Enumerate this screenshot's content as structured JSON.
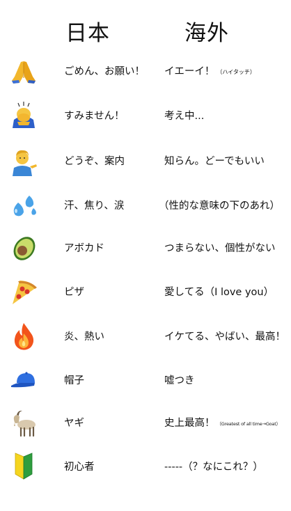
{
  "header": {
    "japan": "日本",
    "overseas": "海外"
  },
  "rows": [
    {
      "emoji": "folded-hands-icon",
      "japan": "ごめん、お願い！",
      "overseas": "イエーイ！",
      "overseas_note": "（ハイタッチ）"
    },
    {
      "emoji": "person-bowing-icon",
      "japan": "すみません！",
      "overseas": "考え中...",
      "overseas_note": ""
    },
    {
      "emoji": "person-tipping-hand-icon",
      "japan": "どうぞ、案内",
      "overseas": "知らん。どーでもいい",
      "overseas_note": ""
    },
    {
      "emoji": "sweat-droplets-icon",
      "japan": "汗、焦り、涙",
      "overseas": "（性的な意味の下のあれ）",
      "overseas_note": ""
    },
    {
      "emoji": "avocado-icon",
      "japan": "アボカド",
      "overseas": "つまらない、個性がない",
      "overseas_note": ""
    },
    {
      "emoji": "pizza-icon",
      "japan": "ピザ",
      "overseas": "愛してる（I love you）",
      "overseas_note": ""
    },
    {
      "emoji": "fire-icon",
      "japan": "炎、熱い",
      "overseas": "イケてる、やばい、最高！",
      "overseas_note": ""
    },
    {
      "emoji": "cap-icon",
      "japan": "帽子",
      "overseas": "嘘つき",
      "overseas_note": ""
    },
    {
      "emoji": "goat-icon",
      "japan": "ヤギ",
      "overseas": "史上最高！",
      "overseas_note": "（Greatest of all time→Goat）"
    },
    {
      "emoji": "beginner-mark-icon",
      "japan": "初心者",
      "overseas": "-----（？なにこれ？）",
      "overseas_note": ""
    }
  ]
}
